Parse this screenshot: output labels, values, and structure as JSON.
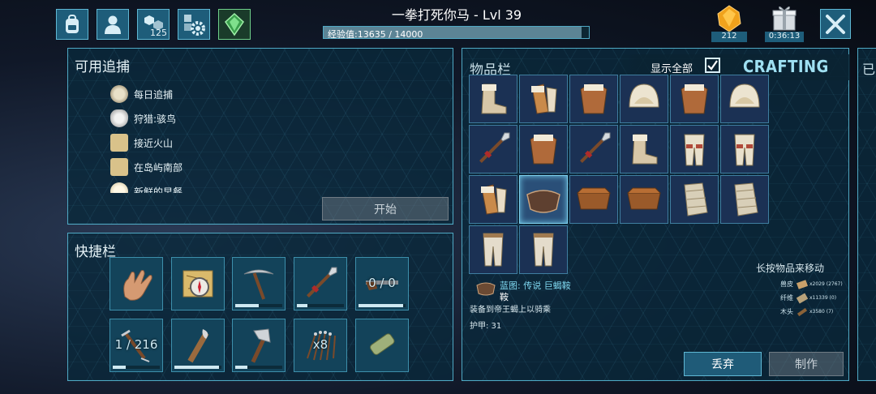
{
  "header": {
    "title": "一拳打死你马 - Lvl 39",
    "xp_label": "经验值:13635 / 14000",
    "xp_fraction": 0.974,
    "engrams_count": "125",
    "gems_count": "212",
    "gift_timer": "0:36:13"
  },
  "quests": {
    "title": "可用追捕",
    "items": [
      {
        "label": "每日追捕",
        "icon": "clock-icon"
      },
      {
        "label": "狩猎:骇鸟",
        "icon": "skull-icon"
      },
      {
        "label": "接近火山",
        "icon": "map-icon"
      },
      {
        "label": "在岛屿南部",
        "icon": "map-icon"
      },
      {
        "label": "新鲜的早餐",
        "icon": "egg-icon"
      }
    ],
    "start_button": "开始"
  },
  "hotbar": {
    "title": "快捷栏",
    "slots": [
      {
        "icon": "hand-icon",
        "overlay": "",
        "durability": null
      },
      {
        "icon": "map-compass-icon",
        "overlay": "",
        "durability": null
      },
      {
        "icon": "pickaxe-icon",
        "overlay": "",
        "durability": 0.5
      },
      {
        "icon": "spear-icon",
        "overlay": "",
        "durability": 0.22
      },
      {
        "icon": "shotgun-icon",
        "overlay": "0 / 0",
        "durability": 0.94
      },
      {
        "icon": "crossbow-icon",
        "overlay": "1 / 216",
        "durability": 0.28
      },
      {
        "icon": "torch-icon",
        "overlay": "",
        "durability": 0.95
      },
      {
        "icon": "hatchet-icon",
        "overlay": "",
        "durability": 0.25
      },
      {
        "icon": "arrows-icon",
        "overlay": "x8",
        "durability": null
      },
      {
        "icon": "spyglass-icon",
        "overlay": "",
        "durability": null
      }
    ]
  },
  "inventory": {
    "title": "物品栏",
    "show_all_label": "显示全部",
    "show_all_checked": true,
    "crafting_label": "CRAFTING",
    "hint": "长按物品来移动",
    "items": [
      "fur-boots-icon",
      "fur-gauntlets-icon",
      "fur-chestpiece-icon",
      "fur-hat-icon",
      "fur-chestpiece-icon",
      "fur-hat-icon",
      "spear-icon",
      "fur-chestpiece-icon",
      "spear-icon",
      "fur-boots-icon",
      "fur-leggings-icon",
      "fur-leggings-icon",
      "fur-gauntlets-icon",
      "saddle-icon",
      "storage-box-icon",
      "storage-box-icon",
      "bandage-icon",
      "bandage-icon",
      "cloth-pants-icon",
      "cloth-pants-icon"
    ],
    "selected_index": 13,
    "detail": {
      "name_line1": "蓝图: 传说 巨蝎鞍",
      "name_line2": "鞍",
      "description": "装备到帝王蝎上以骑乘",
      "armor": "护甲: 31"
    },
    "resources": [
      {
        "label": "兽皮",
        "amount": "x2029 (2767)"
      },
      {
        "label": "纤维",
        "amount": "x11339 (0)"
      },
      {
        "label": "木头",
        "amount": "x3580 (7)"
      }
    ],
    "drop_button": "丢弃",
    "craft_button": "制作"
  },
  "colors": {
    "accent": "#4fa9c4",
    "xp_fill": "#9fd2e6",
    "durability": "#cfe9f2",
    "crafting_text": "#9fe0f2"
  }
}
